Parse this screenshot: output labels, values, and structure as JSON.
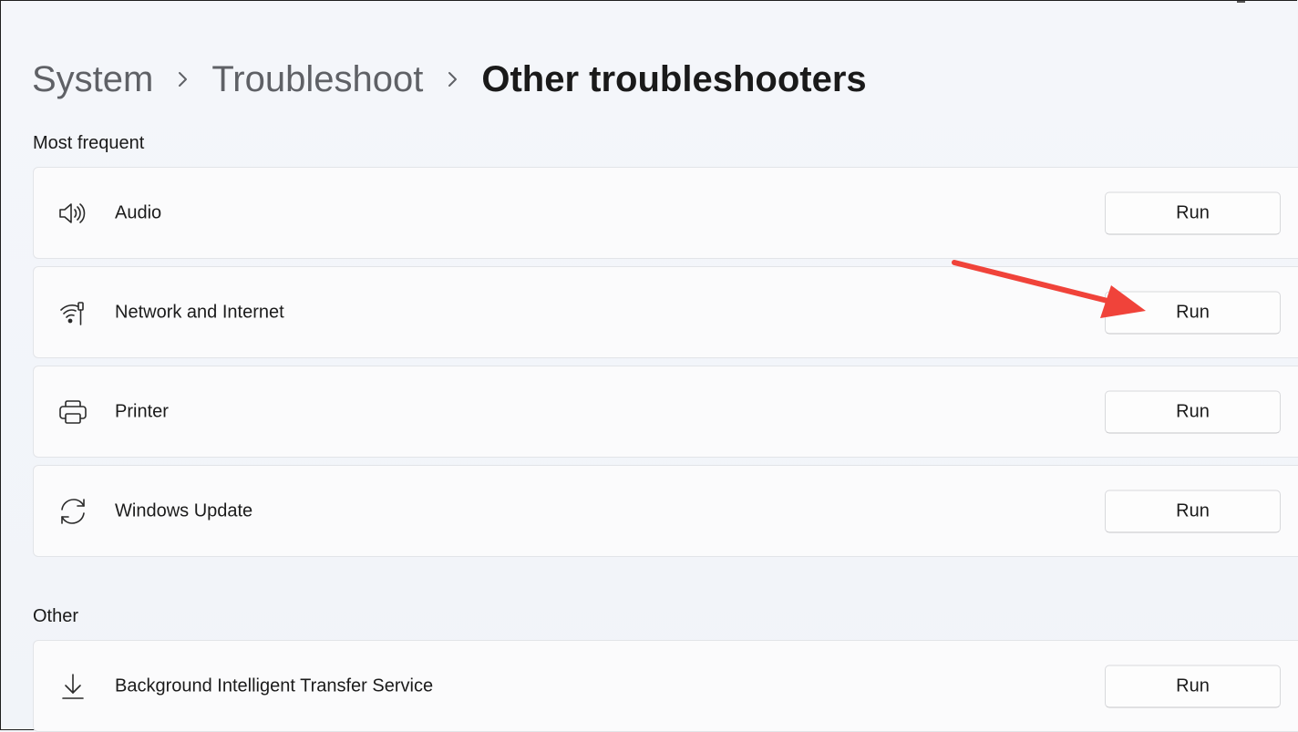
{
  "breadcrumb": {
    "items": [
      "System",
      "Troubleshoot"
    ],
    "current": "Other troubleshooters",
    "separator_icon": "chevron-right-icon"
  },
  "sections": {
    "most_frequent": {
      "title": "Most frequent",
      "items": [
        {
          "label": "Audio",
          "icon": "speaker-icon",
          "button": "Run"
        },
        {
          "label": "Network and Internet",
          "icon": "network-icon",
          "button": "Run"
        },
        {
          "label": "Printer",
          "icon": "printer-icon",
          "button": "Run"
        },
        {
          "label": "Windows Update",
          "icon": "sync-icon",
          "button": "Run"
        }
      ]
    },
    "other": {
      "title": "Other",
      "items": [
        {
          "label": "Background Intelligent Transfer Service",
          "icon": "download-icon",
          "button": "Run"
        }
      ]
    }
  },
  "annotation": {
    "type": "arrow",
    "color": "#f0433a",
    "target": "Network and Internet Run button"
  },
  "colors": {
    "accent_arrow": "#f0433a",
    "card_bg": "#fbfbfc",
    "page_bg": "#f3f5f9"
  }
}
